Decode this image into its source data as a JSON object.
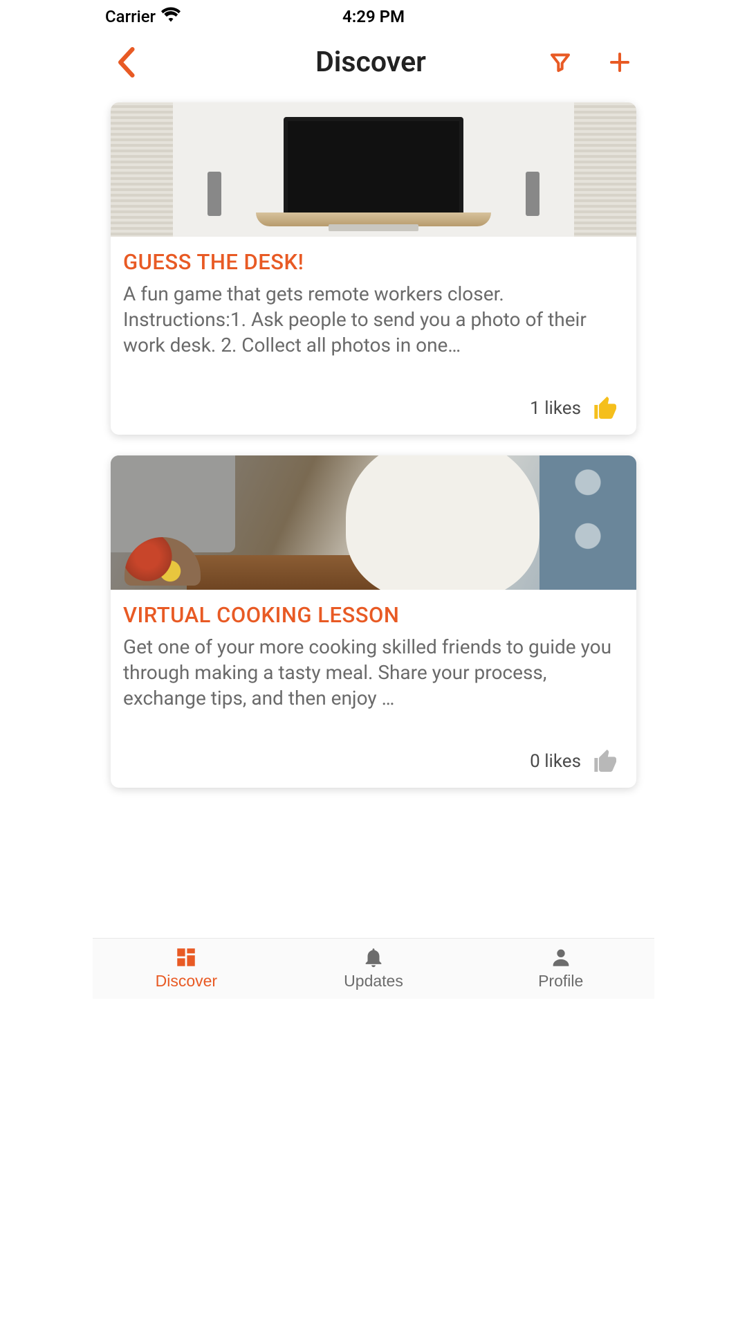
{
  "status": {
    "carrier": "Carrier",
    "time": "4:29 PM"
  },
  "nav": {
    "title": "Discover"
  },
  "colors": {
    "accent": "#e85a24",
    "like_active": "#f5bf1c",
    "like_inactive": "#b8b8b8"
  },
  "cards": [
    {
      "title": "GUESS THE DESK!",
      "description": "A fun game that gets remote workers closer. Instructions:1. Ask people to send you a photo of their work desk. 2. Collect all photos in one…",
      "likes_text": "1 likes",
      "liked": true
    },
    {
      "title": "VIRTUAL COOKING LESSON",
      "description": "Get one of your more cooking skilled friends to guide you through making a tasty meal. Share your process, exchange tips, and then enjoy …",
      "likes_text": "0 likes",
      "liked": false
    }
  ],
  "tabs": [
    {
      "label": "Discover",
      "active": true
    },
    {
      "label": "Updates",
      "active": false
    },
    {
      "label": "Profile",
      "active": false
    }
  ]
}
